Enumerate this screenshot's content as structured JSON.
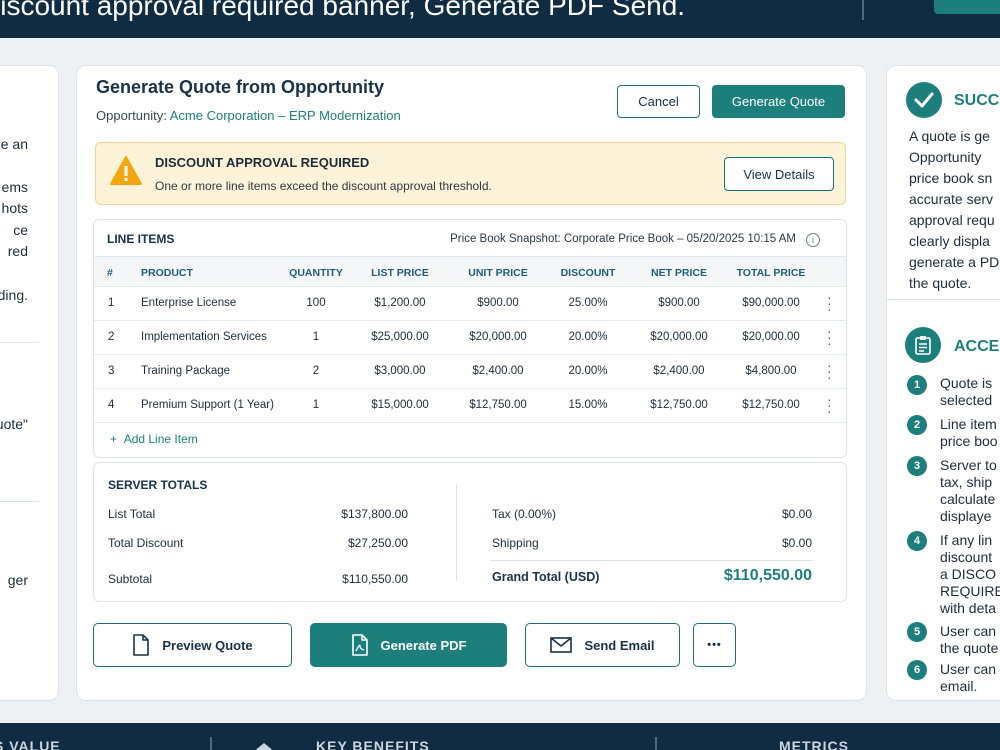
{
  "banner": {
    "title": "Discount approval required banner, Generate PDF Send."
  },
  "left_panel": {
    "lines": [
      "e an",
      "",
      "ems",
      "hots",
      "ce",
      "red",
      "",
      "ding.",
      "uote\"",
      "ger"
    ]
  },
  "main": {
    "title": "Generate Quote from Opportunity",
    "opportunity_label": "Opportunity:",
    "opportunity_value": "Acme Corporation – ERP Modernization",
    "cancel_label": "Cancel",
    "generate_quote_label": "Generate Quote"
  },
  "alert": {
    "title": "DISCOUNT APPROVAL REQUIRED",
    "description": "One or more line items exceed the discount approval threshold.",
    "view_details_label": "View Details",
    "color": "#f4a60d"
  },
  "line_items": {
    "title": "LINE ITEMS",
    "snapshot": "Price Book Snapshot:  Corporate Price Book – 05/20/2025 10:15 AM",
    "columns": [
      "#",
      "PRODUCT",
      "QUANTITY",
      "LIST PRICE",
      "UNIT PRICE",
      "DISCOUNT",
      "NET PRICE",
      "TOTAL PRICE"
    ],
    "rows": [
      [
        "1",
        "Enterprise License",
        "100",
        "$1,200.00",
        "$900.00",
        "25.00%",
        "$900.00",
        "$90,000.00"
      ],
      [
        "2",
        "Implementation Services",
        "1",
        "$25,000.00",
        "$20,000.00",
        "20.00%",
        "$20,000.00",
        "$20,000.00"
      ],
      [
        "3",
        "Training Package",
        "2",
        "$3,000.00",
        "$2,400.00",
        "20.00%",
        "$2,400.00",
        "$4,800.00"
      ],
      [
        "4",
        "Premium Support (1 Year)",
        "1",
        "$15,000.00",
        "$12,750.00",
        "15.00%",
        "$12,750.00",
        "$12,750.00"
      ]
    ],
    "add_label": "Add Line Item"
  },
  "totals": {
    "title": "SERVER TOTALS",
    "list_total_label": "List Total",
    "list_total": "$137,800.00",
    "total_discount_label": "Total Discount",
    "total_discount": "$27,250.00",
    "subtotal_label": "Subtotal",
    "subtotal": "$110,550.00",
    "tax_label": "Tax (0.00%)",
    "tax": "$0.00",
    "shipping_label": "Shipping",
    "shipping": "$0.00",
    "grand_total_label": "Grand Total (USD)",
    "grand_total": "$110,550.00"
  },
  "actions": {
    "preview_label": "Preview Quote",
    "pdf_label": "Generate PDF",
    "email_label": "Send Email",
    "more_label": "•••"
  },
  "right_panel": {
    "success_heading": "SUCC",
    "success_text": [
      "A quote is ge",
      "Opportunity",
      "price book sn",
      "accurate serv",
      "approval requ",
      "clearly displa",
      "generate a PD",
      "the quote."
    ],
    "acceptance_heading": "ACCE",
    "steps": [
      {
        "n": "1",
        "lines": [
          "Quote is",
          "selected"
        ]
      },
      {
        "n": "2",
        "lines": [
          "Line item",
          "price boo"
        ]
      },
      {
        "n": "3",
        "lines": [
          "Server to",
          "tax, ship",
          "calculate",
          "displaye"
        ]
      },
      {
        "n": "4",
        "lines": [
          "If any lin",
          "discount",
          "a DISCO",
          "REQUIRE",
          "with deta"
        ]
      },
      {
        "n": "5",
        "lines": [
          "User can",
          "the quote"
        ]
      },
      {
        "n": "6",
        "lines": [
          "User can",
          "email."
        ]
      }
    ]
  },
  "footer": {
    "items": [
      "S VALUE",
      "KEY BENEFITS",
      "METRICS"
    ]
  },
  "colors": {
    "primary": "#1d7f7b",
    "navy": "#0f2c43",
    "alert_bg": "#fdf3d9"
  }
}
